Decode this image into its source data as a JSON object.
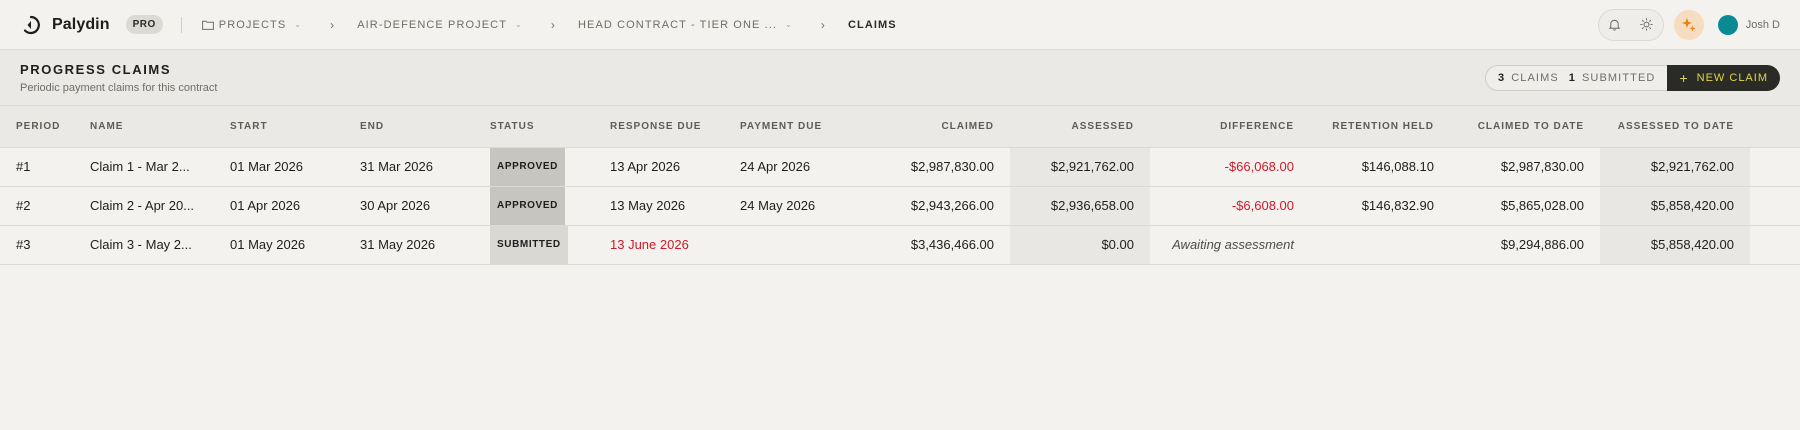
{
  "app": {
    "name": "Palydin",
    "tier": "PRO"
  },
  "breadcrumbs": [
    {
      "label": "PROJECTS",
      "dropdown": true,
      "icon": "folder-icon"
    },
    {
      "label": "AIR-DEFENCE PROJECT",
      "dropdown": true
    },
    {
      "label": "HEAD CONTRACT - TIER ONE ...",
      "dropdown": true
    },
    {
      "label": "CLAIMS",
      "dropdown": false
    }
  ],
  "user": {
    "name": "Josh D",
    "avatar_color": "#0b8a95"
  },
  "header": {
    "title": "PROGRESS CLAIMS",
    "subtitle": "Periodic payment claims for this contract",
    "claims_count": "3",
    "claims_label": "CLAIMS",
    "submitted_count": "1",
    "submitted_label": "SUBMITTED",
    "new_claim_label": "NEW CLAIM"
  },
  "table": {
    "columns": [
      "PERIOD",
      "NAME",
      "START",
      "END",
      "STATUS",
      "RESPONSE DUE",
      "PAYMENT DUE",
      "CLAIMED",
      "ASSESSED",
      "DIFFERENCE",
      "RETENTION HELD",
      "CLAIMED TO DATE",
      "ASSESSED TO DATE"
    ],
    "rows": [
      {
        "period": "#1",
        "name": "Claim 1 - Mar 2...",
        "start": "01 Mar 2026",
        "end": "31 Mar 2026",
        "status": "APPROVED",
        "response_due": "13 Apr 2026",
        "payment_due": "24 Apr 2026",
        "claimed": "$2,987,830.00",
        "assessed": "$2,921,762.00",
        "difference": "-$66,068.00",
        "retention": "$146,088.10",
        "claimed_to_date": "$2,987,830.00",
        "assessed_to_date": "$2,921,762.00"
      },
      {
        "period": "#2",
        "name": "Claim 2 - Apr 20...",
        "start": "01 Apr 2026",
        "end": "30 Apr 2026",
        "status": "APPROVED",
        "response_due": "13 May 2026",
        "payment_due": "24 May 2026",
        "claimed": "$2,943,266.00",
        "assessed": "$2,936,658.00",
        "difference": "-$6,608.00",
        "retention": "$146,832.90",
        "claimed_to_date": "$5,865,028.00",
        "assessed_to_date": "$5,858,420.00"
      },
      {
        "period": "#3",
        "name": "Claim 3 - May 2...",
        "start": "01 May 2026",
        "end": "31 May 2026",
        "status": "SUBMITTED",
        "response_due": "13 June 2026",
        "payment_due": "",
        "claimed": "$3,436,466.00",
        "assessed": "$0.00",
        "difference": "Awaiting assessment",
        "retention": "",
        "claimed_to_date": "$9,294,886.00",
        "assessed_to_date": "$5,858,420.00"
      }
    ]
  },
  "colors": {
    "accent": "#e3d54a",
    "negative": "#cf1a2b",
    "dark": "#2a2a26"
  }
}
